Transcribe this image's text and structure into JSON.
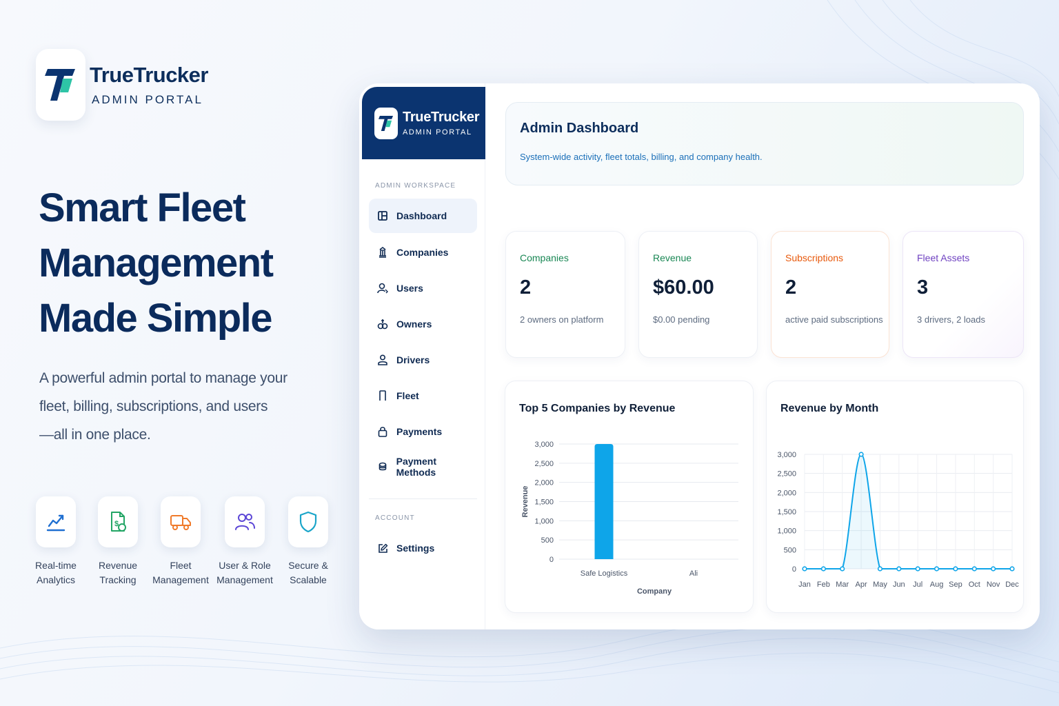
{
  "brand": {
    "name": "TrueTrucker",
    "subtitle": "ADMIN PORTAL"
  },
  "hero": {
    "title_lines": [
      "Smart Fleet",
      "Management",
      "Made Simple"
    ],
    "desc_lines": [
      "A powerful admin portal to manage your",
      "fleet, billing, subscriptions, and users",
      "—all in one place."
    ]
  },
  "features": [
    {
      "icon": "analytics-chart-icon",
      "lines": [
        "Real-time",
        "Analytics"
      ],
      "color": "#1f6fd1"
    },
    {
      "icon": "revenue-document-icon",
      "lines": [
        "Revenue",
        "Tracking"
      ],
      "color": "#22a565"
    },
    {
      "icon": "truck-icon",
      "lines": [
        "Fleet",
        "Management"
      ],
      "color": "#f07a2a"
    },
    {
      "icon": "users-icon",
      "lines": [
        "User & Role",
        "Management"
      ],
      "color": "#5b46d6"
    },
    {
      "icon": "shield-icon",
      "lines": [
        "Secure &",
        "Scalable"
      ],
      "color": "#1aa5c9"
    }
  ],
  "sidebar": {
    "brand_name": "TrueTrucker",
    "brand_sub": "ADMIN PORTAL",
    "workspace_label": "ADMIN WORKSPACE",
    "items": [
      {
        "label": "Dashboard",
        "icon": "dashboard-icon"
      },
      {
        "label": "Companies",
        "icon": "building-icon"
      },
      {
        "label": "Users",
        "icon": "user-icon"
      },
      {
        "label": "Owners",
        "icon": "owners-icon"
      },
      {
        "label": "Drivers",
        "icon": "driver-icon"
      },
      {
        "label": "Fleet",
        "icon": "fleet-icon"
      },
      {
        "label": "Payments",
        "icon": "lock-icon"
      },
      {
        "label": "Payment Methods",
        "icon": "database-icon"
      }
    ],
    "account_label": "ACCOUNT",
    "account_items": [
      {
        "label": "Settings",
        "icon": "edit-icon"
      }
    ]
  },
  "header": {
    "title": "Admin Dashboard",
    "subtitle": "System-wide activity, fleet totals, billing, and company health."
  },
  "stats": [
    {
      "label": "Companies",
      "value": "2",
      "note": "2 owners on platform",
      "color": "#198754"
    },
    {
      "label": "Revenue",
      "value": "$60.00",
      "note": "$0.00 pending",
      "color": "#198754"
    },
    {
      "label": "Subscriptions",
      "value": "2",
      "note": "active paid subscriptions",
      "color": "#e8590c"
    },
    {
      "label": "Fleet Assets",
      "value": "3",
      "note": "3 drivers, 2 loads",
      "color": "#6f42c1"
    }
  ],
  "colors": {
    "accent": "#0b3470",
    "bar": "#0ea5e9",
    "line": "#0ea5e9"
  },
  "chart_data": [
    {
      "type": "bar",
      "title": "Top 5 Companies by Revenue",
      "xlabel": "Company",
      "ylabel": "Revenue",
      "categories": [
        "Safe Logistics",
        "Ali"
      ],
      "values": [
        3000,
        0
      ],
      "ylim": [
        0,
        3000
      ],
      "yticks": [
        0,
        500,
        1000,
        1500,
        2000,
        2500,
        3000
      ],
      "ytick_labels": [
        "0",
        "500",
        "1,000",
        "1,500",
        "2,000",
        "2,500",
        "3,000"
      ],
      "grid": true
    },
    {
      "type": "line",
      "title": "Revenue by Month",
      "xlabel": "",
      "ylabel": "",
      "x": [
        "Jan",
        "Feb",
        "Mar",
        "Apr",
        "May",
        "Jun",
        "Jul",
        "Aug",
        "Sep",
        "Oct",
        "Nov",
        "Dec"
      ],
      "values": [
        0,
        0,
        0,
        3000,
        0,
        0,
        0,
        0,
        0,
        0,
        0,
        0
      ],
      "ylim": [
        0,
        3000
      ],
      "yticks": [
        0,
        500,
        1000,
        1500,
        2000,
        2500,
        3000
      ],
      "ytick_labels": [
        "0",
        "500",
        "1,000",
        "1,500",
        "2,000",
        "2,500",
        "3,000"
      ],
      "grid": true
    }
  ]
}
